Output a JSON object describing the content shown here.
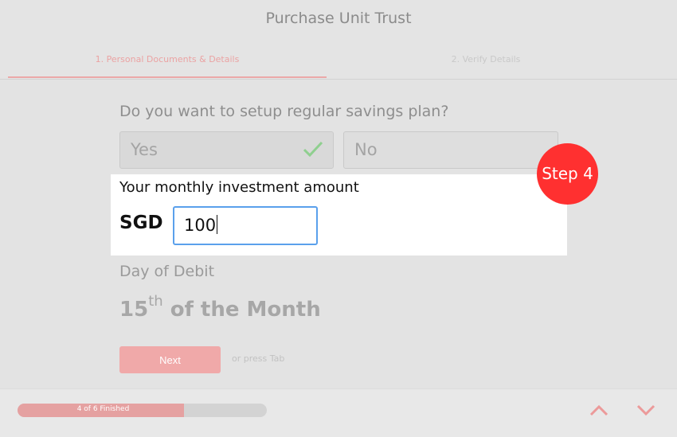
{
  "header": {
    "title": "Purchase Unit Trust",
    "tabs": [
      {
        "label": "1.  Personal Documents & Details",
        "active": true
      },
      {
        "label": "2.  Verify Details",
        "active": false
      }
    ]
  },
  "form": {
    "question": "Do you want to setup regular savings plan?",
    "options": [
      {
        "label": "Yes",
        "selected": true
      },
      {
        "label": "No",
        "selected": false
      }
    ],
    "amount": {
      "label": "Your monthly investment amount",
      "currency": "SGD",
      "value": "100"
    },
    "debit": {
      "label": "Day of Debit",
      "day": "15",
      "suffix": "th",
      "rest": " of the Month"
    },
    "next_label": "Next",
    "tab_hint": "or press Tab"
  },
  "overlay": {
    "step_badge": "Step 4"
  },
  "footer": {
    "progress_text": "4 of 6 Finished",
    "progress_fraction": 0.667
  },
  "colors": {
    "accent": "#ff3030",
    "input_focus": "#5aa0ec",
    "check": "#8fcf8f"
  }
}
